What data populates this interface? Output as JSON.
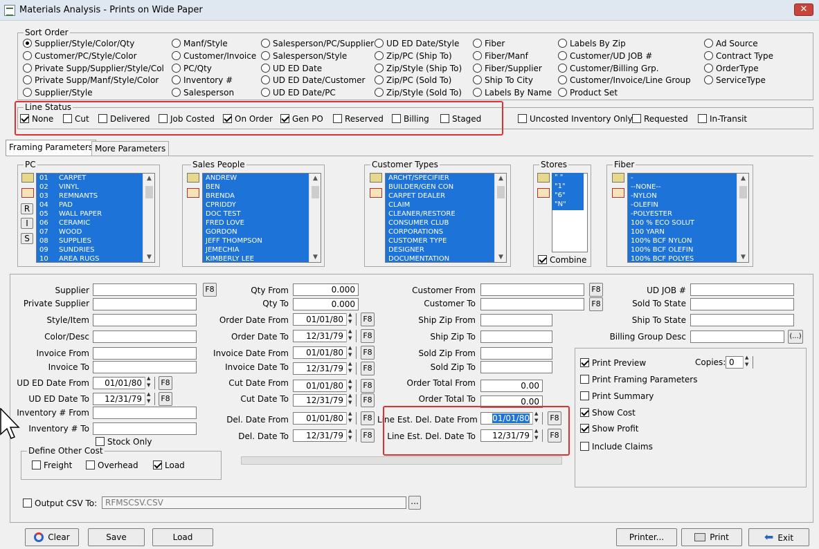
{
  "window": {
    "title": "Materials Analysis  -  Prints on Wide Paper",
    "close": "✕"
  },
  "sort_order": {
    "label": "Sort Order",
    "options": [
      "Supplier/Style/Color/Qty",
      "Customer/PC/Style/Color",
      "Private Supp/Supplier/Style/Col",
      "Private Supp/Manf/Style/Color",
      "Supplier/Style",
      "Manf/Style",
      "Customer/Invoice",
      "PC/Qty",
      "Inventory #",
      "Salesperson",
      "Salesperson/PC/Supplier",
      "Salesperson/Style",
      "UD ED Date",
      "UD ED Date/Customer",
      "UD ED Date/PC",
      "UD ED Date/Style",
      "Zip/PC (Ship To)",
      "Zip/Style (Ship To)",
      "Zip/PC (Sold To)",
      "Zip/Style (Sold To)",
      "Fiber",
      "Fiber/Manf",
      "Fiber/Supplier",
      "Ship To City",
      "Labels By Name",
      "Labels By Zip",
      "Customer/UD JOB #",
      "Customer/Billing Grp.",
      "Customer/Invoice/Line Group",
      "Product Set",
      "Ad Source",
      "Contract Type",
      "OrderType",
      "ServiceType"
    ]
  },
  "line_status": {
    "label": "Line Status",
    "items": [
      {
        "label": "None",
        "checked": true
      },
      {
        "label": "Cut",
        "checked": false
      },
      {
        "label": "Delivered",
        "checked": false
      },
      {
        "label": "Job Costed",
        "checked": false
      },
      {
        "label": "On Order",
        "checked": true
      },
      {
        "label": "Gen PO",
        "checked": true
      },
      {
        "label": "Reserved",
        "checked": false
      },
      {
        "label": "Billing",
        "checked": false
      },
      {
        "label": "Staged",
        "checked": false
      }
    ],
    "extra": [
      {
        "label": "Uncosted Inventory Only",
        "checked": false
      },
      {
        "label": "Requested",
        "checked": false
      },
      {
        "label": "In-Transit",
        "checked": false
      }
    ]
  },
  "tabs": [
    "Framing Parameters",
    "More Parameters"
  ],
  "pc": {
    "label": "PC",
    "buttons": [
      "R",
      "I",
      "S"
    ],
    "rows": [
      [
        "01",
        "CARPET"
      ],
      [
        "02",
        "VINYL"
      ],
      [
        "03",
        "REMNANTS"
      ],
      [
        "04",
        "PAD"
      ],
      [
        "05",
        "WALL PAPER"
      ],
      [
        "06",
        "CERAMIC"
      ],
      [
        "07",
        "WOOD"
      ],
      [
        "08",
        "SUPPLIES"
      ],
      [
        "09",
        "SUNDRIES"
      ],
      [
        "10",
        "AREA RUGS"
      ]
    ]
  },
  "sales_people": {
    "label": "Sales People",
    "rows": [
      "ANDREW",
      "BEN",
      "BRENDA",
      "CPRIDDY",
      "DOC TEST",
      "FRED LOVE",
      "GORDON",
      "JEFF THOMPSON",
      "JEMECHIA",
      "KIMBERLY LEE"
    ]
  },
  "customer_types": {
    "label": "Customer Types",
    "rows": [
      "ARCHT/SPECIFIER",
      "BUILDER/GEN CON",
      "CARPET DEALER",
      "CLAIM",
      "CLEANER/RESTORE",
      "CONSUMER CLUB",
      "CORPORATIONS",
      "CUSTOMER TYPE",
      "DESIGNER",
      "DOCUMENTATION"
    ]
  },
  "stores": {
    "label": "Stores",
    "rows": [
      "\" \"",
      "\"1\"",
      "\"6\"",
      "\"N\""
    ],
    "combine": "Combine"
  },
  "fiber": {
    "label": "Fiber",
    "rows": [
      "-",
      "--NONE--",
      "-NYLON",
      "-OLEFIN",
      "-POLYESTER",
      "100 % ECO SOLUT",
      "100 YARN",
      "100% BCF NYLON",
      "100% BCF OLEFIN",
      "100% BCF POLYES"
    ]
  },
  "col1": {
    "supplier": "Supplier",
    "private_supplier": "Private Supplier",
    "style_item": "Style/Item",
    "color_desc": "Color/Desc",
    "invoice_from": "Invoice From",
    "invoice_to": "Invoice To",
    "ud_ed_from": "UD ED Date From",
    "ud_ed_from_val": "01/01/80",
    "ud_ed_to": "UD ED Date To",
    "ud_ed_to_val": "12/31/79",
    "inv_from": "Inventory # From",
    "inv_to": "Inventory # To",
    "stock_only": "Stock Only",
    "f8": "F8"
  },
  "other_cost": {
    "label": "Define Other Cost",
    "items": [
      {
        "label": "Freight",
        "checked": false
      },
      {
        "label": "Overhead",
        "checked": false
      },
      {
        "label": "Load",
        "checked": true
      }
    ]
  },
  "col2": {
    "qty_from": "Qty From",
    "qty_from_val": "0.000",
    "qty_to": "Qty To",
    "qty_to_val": "0.000",
    "order_from": "Order Date From",
    "order_from_val": "01/01/80",
    "order_to": "Order Date To",
    "order_to_val": "12/31/79",
    "inv_date_from": "Invoice Date From",
    "inv_date_from_val": "01/01/80",
    "inv_date_to": "Invoice Date To",
    "inv_date_to_val": "12/31/79",
    "cut_from": "Cut Date From",
    "cut_from_val": "01/01/80",
    "cut_to": "Cut Date To",
    "cut_to_val": "12/31/79",
    "del_from": "Del. Date From",
    "del_from_val": "01/01/80",
    "del_to": "Del. Date To",
    "del_to_val": "12/31/79"
  },
  "col3": {
    "cust_from": "Customer From",
    "cust_to": "Customer To",
    "ship_zip_from": "Ship Zip From",
    "ship_zip_to": "Ship Zip To",
    "sold_zip_from": "Sold Zip From",
    "sold_zip_to": "Sold Zip To",
    "order_total_from": "Order Total From",
    "order_total_from_val": "0.00",
    "order_total_to": "Order Total To",
    "order_total_to_val": "0.00",
    "line_est_from": "Line Est. Del. Date From",
    "line_est_from_val": "01/01/80",
    "line_est_to": "Line Est. Del. Date To",
    "line_est_to_val": "12/31/79"
  },
  "col4": {
    "ud_job": "UD JOB #",
    "sold_to_state": "Sold To State",
    "ship_to_state": "Ship To State",
    "billing_group": "Billing Group Desc",
    "ellipsis": "(...)"
  },
  "print_opts": {
    "copies_label": "Copies:",
    "copies": "0",
    "items": [
      {
        "label": "Print Preview",
        "checked": true
      },
      {
        "label": "Print Framing Parameters",
        "checked": false
      },
      {
        "label": "Print Summary",
        "checked": false
      },
      {
        "label": "Show Cost",
        "checked": true
      },
      {
        "label": "Show Profit",
        "checked": true
      },
      {
        "label": "Include Claims",
        "checked": false
      }
    ]
  },
  "csv": {
    "label": "Output CSV To:",
    "value": "RFMSCSV.CSV",
    "browse": "..."
  },
  "footer": {
    "clear": "Clear",
    "save": "Save",
    "load": "Load",
    "printer": "Printer...",
    "print": "Print",
    "exit": "Exit"
  }
}
